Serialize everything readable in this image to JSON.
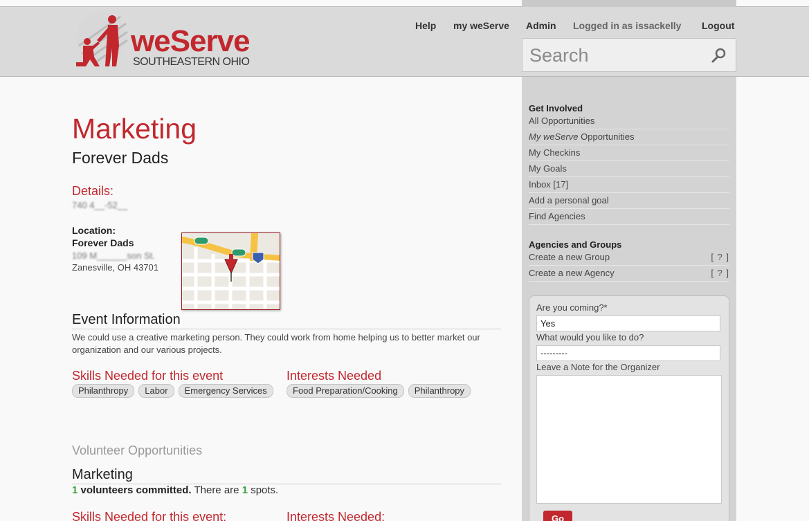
{
  "header": {
    "logo_name": "weServe",
    "logo_region": "SOUTHEASTERN OHIO",
    "nav": {
      "help": "Help",
      "my_weserve": "my weServe",
      "admin": "Admin",
      "logged_in": "Logged in as issackelly",
      "logout": "Logout"
    },
    "search_placeholder": "Search"
  },
  "event": {
    "title": "Marketing",
    "organization": "Forever Dads",
    "details_label": "Details:",
    "details_value": "740 4__-52__",
    "location_label": "Location:",
    "location_name": "Forever Dads",
    "location_street": "109 M______son St.",
    "location_city": "Zanesville, OH 43701",
    "info_heading": "Event Information",
    "description": "We could use a creative marketing person. They could work from home helping us to better market our organization and our various projects.",
    "skills_heading": "Skills Needed for this event",
    "skills": [
      "Philanthropy",
      "Labor",
      "Emergency Services"
    ],
    "interests_heading": "Interests Needed",
    "interests": [
      "Food Preparation/Cooking",
      "Philanthropy"
    ]
  },
  "opportunities": {
    "heading": "Volunteer Opportunities",
    "item_title": "Marketing",
    "committed_count": "1",
    "committed_label": "volunteers committed.",
    "there_are": "There are",
    "spots_count": "1",
    "spots_label": "spots.",
    "skills_heading": "Skills Needed for this event:",
    "interests_heading": "Interests Needed:"
  },
  "sidebar": {
    "get_involved_heading": "Get Involved",
    "get_involved": [
      "All Opportunities",
      "Opportunities",
      "My Checkins",
      "My Goals",
      "Inbox [17]",
      "Add a personal goal",
      "Find Agencies"
    ],
    "my_weserve_italic": "My weServe",
    "agencies_heading": "Agencies and Groups",
    "agencies": [
      "Create a new Group",
      "Create a new Agency"
    ],
    "help_marker": "[ ? ]"
  },
  "rsvp": {
    "coming_label": "Are you coming?*",
    "coming_value": "Yes",
    "todo_label": "What would you like to do?",
    "todo_value": "---------",
    "note_label": "Leave a Note for the Organizer",
    "go_label": "Go"
  },
  "colors": {
    "brand_red": "#c1272d",
    "count_green": "#3aa23a",
    "sidebar_bg": "#d3d3d3",
    "header_bg": "#dadada"
  }
}
